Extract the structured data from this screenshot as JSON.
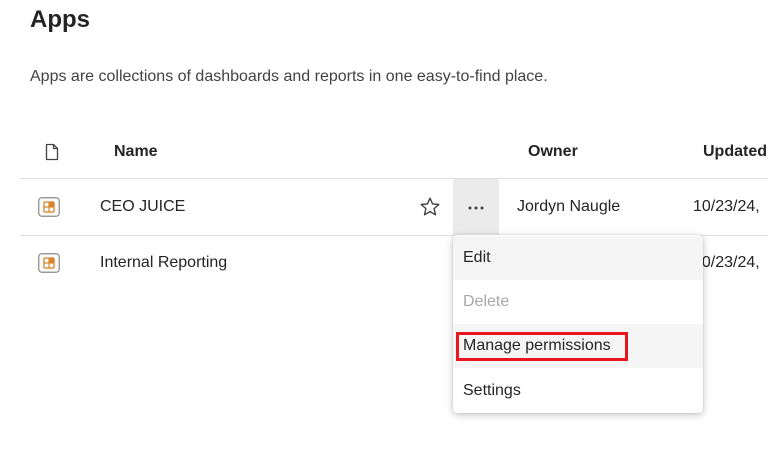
{
  "page": {
    "title": "Apps",
    "description": "Apps are collections of dashboards and reports in one easy-to-find place."
  },
  "table": {
    "columns": {
      "type_icon": "file-icon",
      "name": "Name",
      "owner": "Owner",
      "updated": "Updated"
    },
    "rows": [
      {
        "name": "CEO JUICE",
        "owner": "Jordyn Naugle",
        "updated": "10/23/24,",
        "icon": "app-icon"
      },
      {
        "name": "Internal Reporting",
        "owner": "",
        "updated": "10/23/24,",
        "icon": "app-icon"
      }
    ]
  },
  "context_menu": {
    "items": [
      {
        "label": "Edit",
        "enabled": true
      },
      {
        "label": "Delete",
        "enabled": false
      },
      {
        "label": "Manage permissions",
        "enabled": true,
        "highlighted": true
      },
      {
        "label": "Settings",
        "enabled": true
      }
    ]
  },
  "colors": {
    "app_icon_accent": "#d9822b",
    "highlight": "#e8141e",
    "hover_bg": "#ebebeb"
  }
}
